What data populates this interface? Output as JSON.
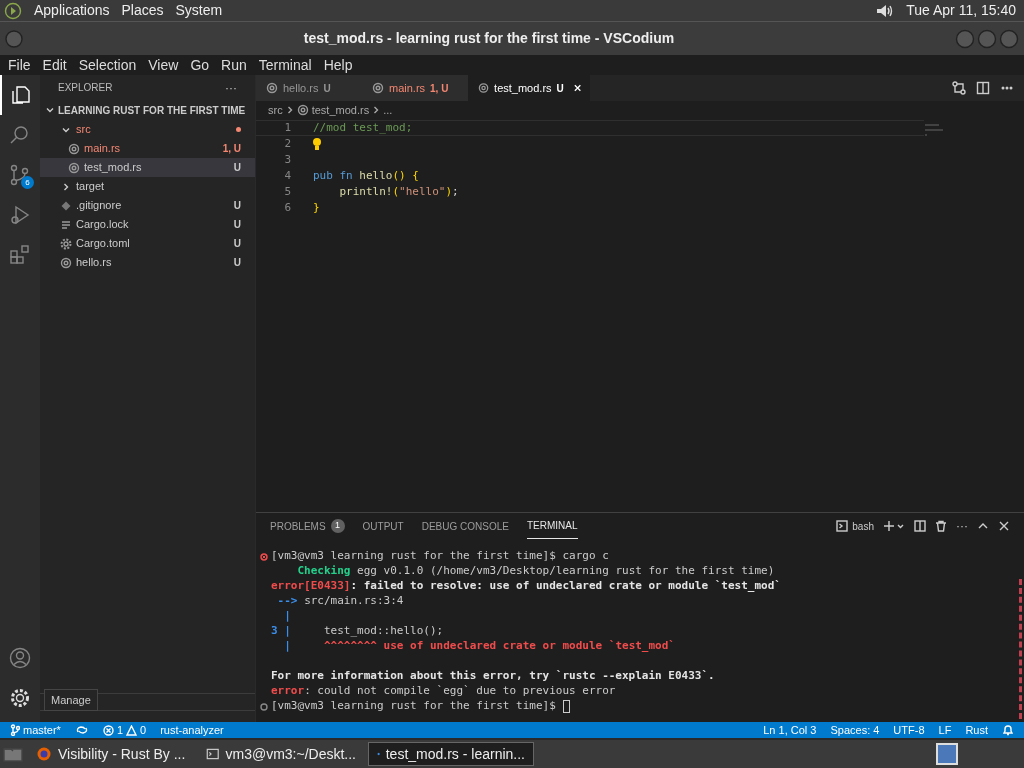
{
  "top_panel": {
    "menus": [
      "Applications",
      "Places",
      "System"
    ],
    "clock": "Tue Apr 11, 15:40"
  },
  "window": {
    "title": "test_mod.rs - learning rust for the first time - VSCodium"
  },
  "menu_bar": [
    "File",
    "Edit",
    "Selection",
    "View",
    "Go",
    "Run",
    "Terminal",
    "Help"
  ],
  "activity_bar": [
    {
      "kind": "explorer",
      "selected": true
    },
    {
      "kind": "search",
      "selected": false
    },
    {
      "kind": "scm",
      "selected": false,
      "badge": "6"
    },
    {
      "kind": "debug",
      "selected": false
    },
    {
      "kind": "extensions",
      "selected": false
    }
  ],
  "sidebar": {
    "title": "EXPLORER",
    "more": "···",
    "root": {
      "label": "LEARNING RUST FOR THE FIRST TIME",
      "expanded": true,
      "children": [
        {
          "label": "src",
          "kind": "folder",
          "expanded": true,
          "error": true,
          "children": [
            {
              "label": "main.rs",
              "kind": "rust",
              "error": true,
              "badge": "1, U",
              "selected": false
            },
            {
              "label": "test_mod.rs",
              "kind": "rust",
              "error": false,
              "badge": "U",
              "selected": true
            }
          ]
        },
        {
          "label": "target",
          "kind": "folder",
          "expanded": false,
          "error": false
        },
        {
          "label": ".gitignore",
          "kind": "git",
          "error": false,
          "badge": "U",
          "selected": false
        },
        {
          "label": "Cargo.lock",
          "kind": "lock",
          "error": false,
          "badge": "U",
          "selected": false
        },
        {
          "label": "Cargo.toml",
          "kind": "toml",
          "error": false,
          "badge": "U",
          "selected": false
        },
        {
          "label": "hello.rs",
          "kind": "rust",
          "error": false,
          "badge": "U",
          "selected": false
        }
      ]
    }
  },
  "tabs": [
    {
      "label": "hello.rs",
      "badge": "U",
      "error": false,
      "selected": false
    },
    {
      "label": "main.rs",
      "badge": "1, U",
      "error": true,
      "selected": false
    },
    {
      "label": "test_mod.rs",
      "badge": "U",
      "error": false,
      "selected": true
    }
  ],
  "breadcrumb": [
    "src",
    "test_mod.rs",
    "..."
  ],
  "editor": {
    "lines": [
      {
        "number": "1",
        "tokens": [
          {
            "kind": "comment",
            "text": "//mod test_mod;"
          }
        ]
      },
      {
        "number": "2",
        "lightbulb": true
      },
      {
        "number": "3"
      },
      {
        "number": "4",
        "tokens": [
          {
            "kind": "keyword",
            "text": "pub"
          },
          {
            "kind": "keyword",
            "text": " fn"
          },
          {
            "kind": "function",
            "text": " hello"
          },
          {
            "kind": "bracket",
            "text": "() {"
          }
        ]
      },
      {
        "number": "5",
        "tokens": [
          {
            "kind": "function",
            "text": "    println!"
          },
          {
            "kind": "bracket",
            "text": "("
          },
          {
            "kind": "string",
            "text": "\"hello\""
          },
          {
            "kind": "bracket",
            "text": ")"
          },
          {
            "kind": "plain",
            "text": ";"
          }
        ]
      },
      {
        "number": "6",
        "tokens": [
          {
            "kind": "bracket",
            "text": "}"
          }
        ]
      }
    ]
  },
  "panel": {
    "tabs": [
      {
        "label": "PROBLEMS",
        "count": "1",
        "selected": false
      },
      {
        "label": "OUTPUT",
        "selected": false
      },
      {
        "label": "DEBUG CONSOLE",
        "selected": false
      },
      {
        "label": "TERMINAL",
        "selected": true
      }
    ],
    "shell": "bash",
    "more": "···",
    "terminal": [
      {
        "kind": "failed_command",
        "segments": [
          {
            "kind": "plain",
            "text": "[vm3@vm3 learning rust for the first time]$ cargo c"
          }
        ]
      },
      {
        "kind": "output",
        "segments": [
          {
            "kind": "success",
            "text": "    Checking"
          },
          {
            "kind": "plain",
            "text": " egg v0.1.0 (/home/vm3/Desktop/learning rust for the first time)"
          }
        ]
      },
      {
        "kind": "output",
        "segments": [
          {
            "kind": "error",
            "text": "error[E0433]"
          },
          {
            "kind": "bold",
            "text": ": failed to resolve: use of undeclared crate or module `test_mod`"
          }
        ]
      },
      {
        "kind": "output",
        "segments": [
          {
            "kind": "info",
            "text": " --> "
          },
          {
            "kind": "plain",
            "text": "src/main.rs:3:4"
          }
        ]
      },
      {
        "kind": "output",
        "segments": [
          {
            "kind": "info",
            "text": "  |"
          }
        ]
      },
      {
        "kind": "output",
        "segments": [
          {
            "kind": "info",
            "text": "3 |"
          },
          {
            "kind": "plain",
            "text": "     test_mod::hello();"
          }
        ]
      },
      {
        "kind": "output",
        "segments": [
          {
            "kind": "info",
            "text": "  |"
          },
          {
            "kind": "error",
            "text": "     ^^^^^^^^ use of undeclared crate or module `test_mod`"
          }
        ]
      },
      {
        "kind": "output"
      },
      {
        "kind": "output",
        "segments": [
          {
            "kind": "bold",
            "text": "For more information about this error, try `rustc --explain E0433`."
          }
        ]
      },
      {
        "kind": "output",
        "segments": [
          {
            "kind": "error",
            "text": "error"
          },
          {
            "kind": "plain",
            "text": ": could not compile `egg` due to previous error"
          }
        ]
      },
      {
        "kind": "prompt",
        "cursor": true,
        "segments": [
          {
            "kind": "plain",
            "text": "[vm3@vm3 learning rust for the first time]$"
          }
        ]
      }
    ]
  },
  "tooltip": "Manage",
  "status_bar": {
    "left": [
      {
        "kind": "branch",
        "text": "master*"
      },
      {
        "kind": "sync"
      },
      {
        "kind": "problems",
        "errors": "1",
        "warnings": "0"
      },
      {
        "kind": "text",
        "text": "rust-analyzer"
      }
    ],
    "right": [
      {
        "kind": "text",
        "text": "Ln 1, Col 3"
      },
      {
        "kind": "text",
        "text": "Spaces: 4"
      },
      {
        "kind": "text",
        "text": "UTF-8"
      },
      {
        "kind": "text",
        "text": "LF"
      },
      {
        "kind": "text",
        "text": "Rust"
      },
      {
        "kind": "bell"
      }
    ]
  },
  "taskbar": [
    {
      "kind": "browser",
      "label": "Visibility - Rust By ...",
      "selected": false
    },
    {
      "kind": "terminal",
      "label": "vm3@vm3:~/Deskt...",
      "selected": false
    },
    {
      "kind": "editor",
      "label": "test_mod.rs - learnin...",
      "selected": true
    }
  ]
}
